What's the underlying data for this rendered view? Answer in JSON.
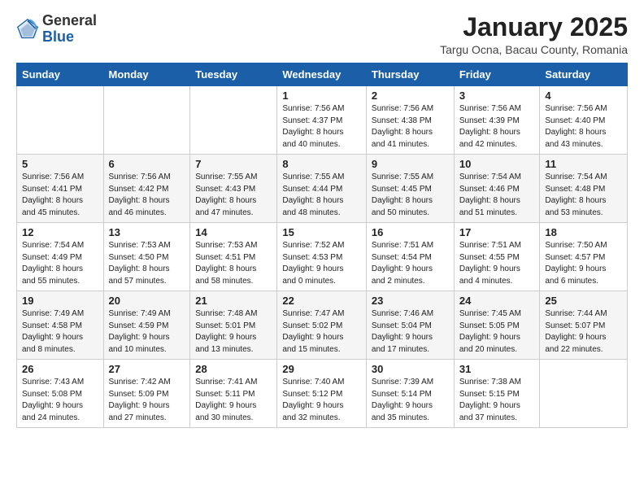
{
  "logo": {
    "general": "General",
    "blue": "Blue"
  },
  "header": {
    "month": "January 2025",
    "location": "Targu Ocna, Bacau County, Romania"
  },
  "weekdays": [
    "Sunday",
    "Monday",
    "Tuesday",
    "Wednesday",
    "Thursday",
    "Friday",
    "Saturday"
  ],
  "weeks": [
    [
      {
        "day": "",
        "info": ""
      },
      {
        "day": "",
        "info": ""
      },
      {
        "day": "",
        "info": ""
      },
      {
        "day": "1",
        "info": "Sunrise: 7:56 AM\nSunset: 4:37 PM\nDaylight: 8 hours\nand 40 minutes."
      },
      {
        "day": "2",
        "info": "Sunrise: 7:56 AM\nSunset: 4:38 PM\nDaylight: 8 hours\nand 41 minutes."
      },
      {
        "day": "3",
        "info": "Sunrise: 7:56 AM\nSunset: 4:39 PM\nDaylight: 8 hours\nand 42 minutes."
      },
      {
        "day": "4",
        "info": "Sunrise: 7:56 AM\nSunset: 4:40 PM\nDaylight: 8 hours\nand 43 minutes."
      }
    ],
    [
      {
        "day": "5",
        "info": "Sunrise: 7:56 AM\nSunset: 4:41 PM\nDaylight: 8 hours\nand 45 minutes."
      },
      {
        "day": "6",
        "info": "Sunrise: 7:56 AM\nSunset: 4:42 PM\nDaylight: 8 hours\nand 46 minutes."
      },
      {
        "day": "7",
        "info": "Sunrise: 7:55 AM\nSunset: 4:43 PM\nDaylight: 8 hours\nand 47 minutes."
      },
      {
        "day": "8",
        "info": "Sunrise: 7:55 AM\nSunset: 4:44 PM\nDaylight: 8 hours\nand 48 minutes."
      },
      {
        "day": "9",
        "info": "Sunrise: 7:55 AM\nSunset: 4:45 PM\nDaylight: 8 hours\nand 50 minutes."
      },
      {
        "day": "10",
        "info": "Sunrise: 7:54 AM\nSunset: 4:46 PM\nDaylight: 8 hours\nand 51 minutes."
      },
      {
        "day": "11",
        "info": "Sunrise: 7:54 AM\nSunset: 4:48 PM\nDaylight: 8 hours\nand 53 minutes."
      }
    ],
    [
      {
        "day": "12",
        "info": "Sunrise: 7:54 AM\nSunset: 4:49 PM\nDaylight: 8 hours\nand 55 minutes."
      },
      {
        "day": "13",
        "info": "Sunrise: 7:53 AM\nSunset: 4:50 PM\nDaylight: 8 hours\nand 57 minutes."
      },
      {
        "day": "14",
        "info": "Sunrise: 7:53 AM\nSunset: 4:51 PM\nDaylight: 8 hours\nand 58 minutes."
      },
      {
        "day": "15",
        "info": "Sunrise: 7:52 AM\nSunset: 4:53 PM\nDaylight: 9 hours\nand 0 minutes."
      },
      {
        "day": "16",
        "info": "Sunrise: 7:51 AM\nSunset: 4:54 PM\nDaylight: 9 hours\nand 2 minutes."
      },
      {
        "day": "17",
        "info": "Sunrise: 7:51 AM\nSunset: 4:55 PM\nDaylight: 9 hours\nand 4 minutes."
      },
      {
        "day": "18",
        "info": "Sunrise: 7:50 AM\nSunset: 4:57 PM\nDaylight: 9 hours\nand 6 minutes."
      }
    ],
    [
      {
        "day": "19",
        "info": "Sunrise: 7:49 AM\nSunset: 4:58 PM\nDaylight: 9 hours\nand 8 minutes."
      },
      {
        "day": "20",
        "info": "Sunrise: 7:49 AM\nSunset: 4:59 PM\nDaylight: 9 hours\nand 10 minutes."
      },
      {
        "day": "21",
        "info": "Sunrise: 7:48 AM\nSunset: 5:01 PM\nDaylight: 9 hours\nand 13 minutes."
      },
      {
        "day": "22",
        "info": "Sunrise: 7:47 AM\nSunset: 5:02 PM\nDaylight: 9 hours\nand 15 minutes."
      },
      {
        "day": "23",
        "info": "Sunrise: 7:46 AM\nSunset: 5:04 PM\nDaylight: 9 hours\nand 17 minutes."
      },
      {
        "day": "24",
        "info": "Sunrise: 7:45 AM\nSunset: 5:05 PM\nDaylight: 9 hours\nand 20 minutes."
      },
      {
        "day": "25",
        "info": "Sunrise: 7:44 AM\nSunset: 5:07 PM\nDaylight: 9 hours\nand 22 minutes."
      }
    ],
    [
      {
        "day": "26",
        "info": "Sunrise: 7:43 AM\nSunset: 5:08 PM\nDaylight: 9 hours\nand 24 minutes."
      },
      {
        "day": "27",
        "info": "Sunrise: 7:42 AM\nSunset: 5:09 PM\nDaylight: 9 hours\nand 27 minutes."
      },
      {
        "day": "28",
        "info": "Sunrise: 7:41 AM\nSunset: 5:11 PM\nDaylight: 9 hours\nand 30 minutes."
      },
      {
        "day": "29",
        "info": "Sunrise: 7:40 AM\nSunset: 5:12 PM\nDaylight: 9 hours\nand 32 minutes."
      },
      {
        "day": "30",
        "info": "Sunrise: 7:39 AM\nSunset: 5:14 PM\nDaylight: 9 hours\nand 35 minutes."
      },
      {
        "day": "31",
        "info": "Sunrise: 7:38 AM\nSunset: 5:15 PM\nDaylight: 9 hours\nand 37 minutes."
      },
      {
        "day": "",
        "info": ""
      }
    ]
  ]
}
